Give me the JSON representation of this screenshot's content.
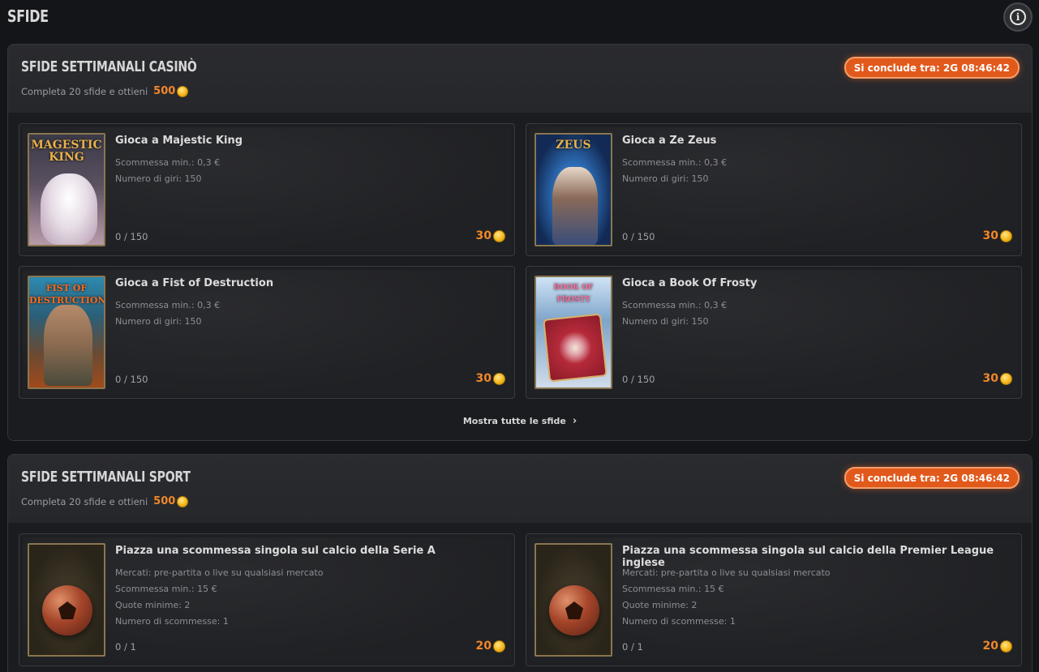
{
  "page": {
    "title": "SFIDE",
    "info_icon": "info-icon"
  },
  "sections": [
    {
      "title": "SFIDE SETTIMANALI CASINÒ",
      "subtitle": "Completa 20 sfide e ottieni",
      "reward": "500",
      "timer": "Si conclude tra: 2G 08:46:42",
      "cards": [
        {
          "title": "Gioca a Majestic King",
          "lines": [
            "Scommessa min.: 0,3 €",
            "Numero di giri: 150"
          ],
          "progress": "0 / 150",
          "reward": "30",
          "thumb_text": "MAGESTIC KING"
        },
        {
          "title": "Gioca a Ze Zeus",
          "lines": [
            "Scommessa min.: 0,3 €",
            "Numero di giri: 150"
          ],
          "progress": "0 / 150",
          "reward": "30",
          "thumb_text": "ZEUS"
        },
        {
          "title": "Gioca a Fist of Destruction",
          "lines": [
            "Scommessa min.: 0,3 €",
            "Numero di giri: 150"
          ],
          "progress": "0 / 150",
          "reward": "30",
          "thumb_text": "FIST OF DESTRUCTION"
        },
        {
          "title": "Gioca a Book Of Frosty",
          "lines": [
            "Scommessa min.: 0,3 €",
            "Numero di giri: 150"
          ],
          "progress": "0 / 150",
          "reward": "30",
          "thumb_text": "BOOK OF FROSTY"
        }
      ],
      "show_all": "Mostra tutte le sfide"
    },
    {
      "title": "SFIDE SETTIMANALI SPORT",
      "subtitle": "Completa 20 sfide e ottieni",
      "reward": "500",
      "timer": "Si conclude tra: 2G 08:46:42",
      "cards": [
        {
          "title": "Piazza una scommessa singola sul calcio della Serie A",
          "lines": [
            "Mercati: pre-partita o live su qualsiasi mercato",
            "Scommessa min.: 15 €",
            "Quote minime: 2",
            "Numero di scommesse: 1"
          ],
          "progress": "0 / 1",
          "reward": "20"
        },
        {
          "title": "Piazza una scommessa singola sul calcio della Premier League inglese",
          "lines": [
            "Mercati: pre-partita o live su qualsiasi mercato",
            "Scommessa min.: 15 €",
            "Quote minime: 2",
            "Numero di scommesse: 1"
          ],
          "progress": "0 / 1",
          "reward": "20"
        }
      ]
    }
  ],
  "colors": {
    "accent": "#f0872a",
    "timer_bg": "#e2591c",
    "background": "#141518"
  }
}
